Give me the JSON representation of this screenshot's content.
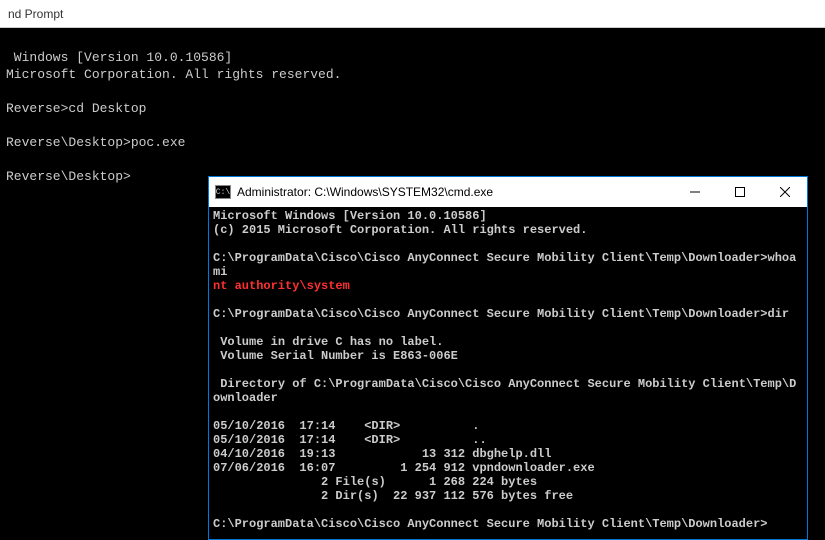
{
  "outer": {
    "title": "nd Prompt",
    "line1": " Windows [Version 10.0.10586]",
    "line2": "Microsoft Corporation. All rights reserved.",
    "prompt1": "Reverse>",
    "cmd1": "cd Desktop",
    "prompt2": "Reverse\\Desktop>",
    "cmd2": "poc.exe",
    "prompt3": "Reverse\\Desktop>"
  },
  "inner": {
    "title": "Administrator: C:\\Windows\\SYSTEM32\\cmd.exe",
    "cmd_icon_text": "C:\\",
    "banner1": "Microsoft Windows [Version 10.0.10586]",
    "banner2": "(c) 2015 Microsoft Corporation. All rights reserved.",
    "prompt_path": "C:\\ProgramData\\Cisco\\Cisco AnyConnect Secure Mobility Client\\Temp\\Downloader>",
    "cmd_whoami": "whoami",
    "whoami_result": "nt authority\\system",
    "cmd_dir": "dir",
    "vol1": " Volume in drive C has no label.",
    "vol2": " Volume Serial Number is E863-006E",
    "dir_of": " Directory of C:\\ProgramData\\Cisco\\Cisco AnyConnect Secure Mobility Client\\Temp\\Downloader",
    "row1": "05/10/2016  17:14    <DIR>          .",
    "row2": "05/10/2016  17:14    <DIR>          ..",
    "row3": "04/10/2016  19:13            13 312 dbghelp.dll",
    "row4": "07/06/2016  16:07         1 254 912 vpndownloader.exe",
    "sum1": "               2 File(s)      1 268 224 bytes",
    "sum2": "               2 Dir(s)  22 937 112 576 bytes free"
  }
}
